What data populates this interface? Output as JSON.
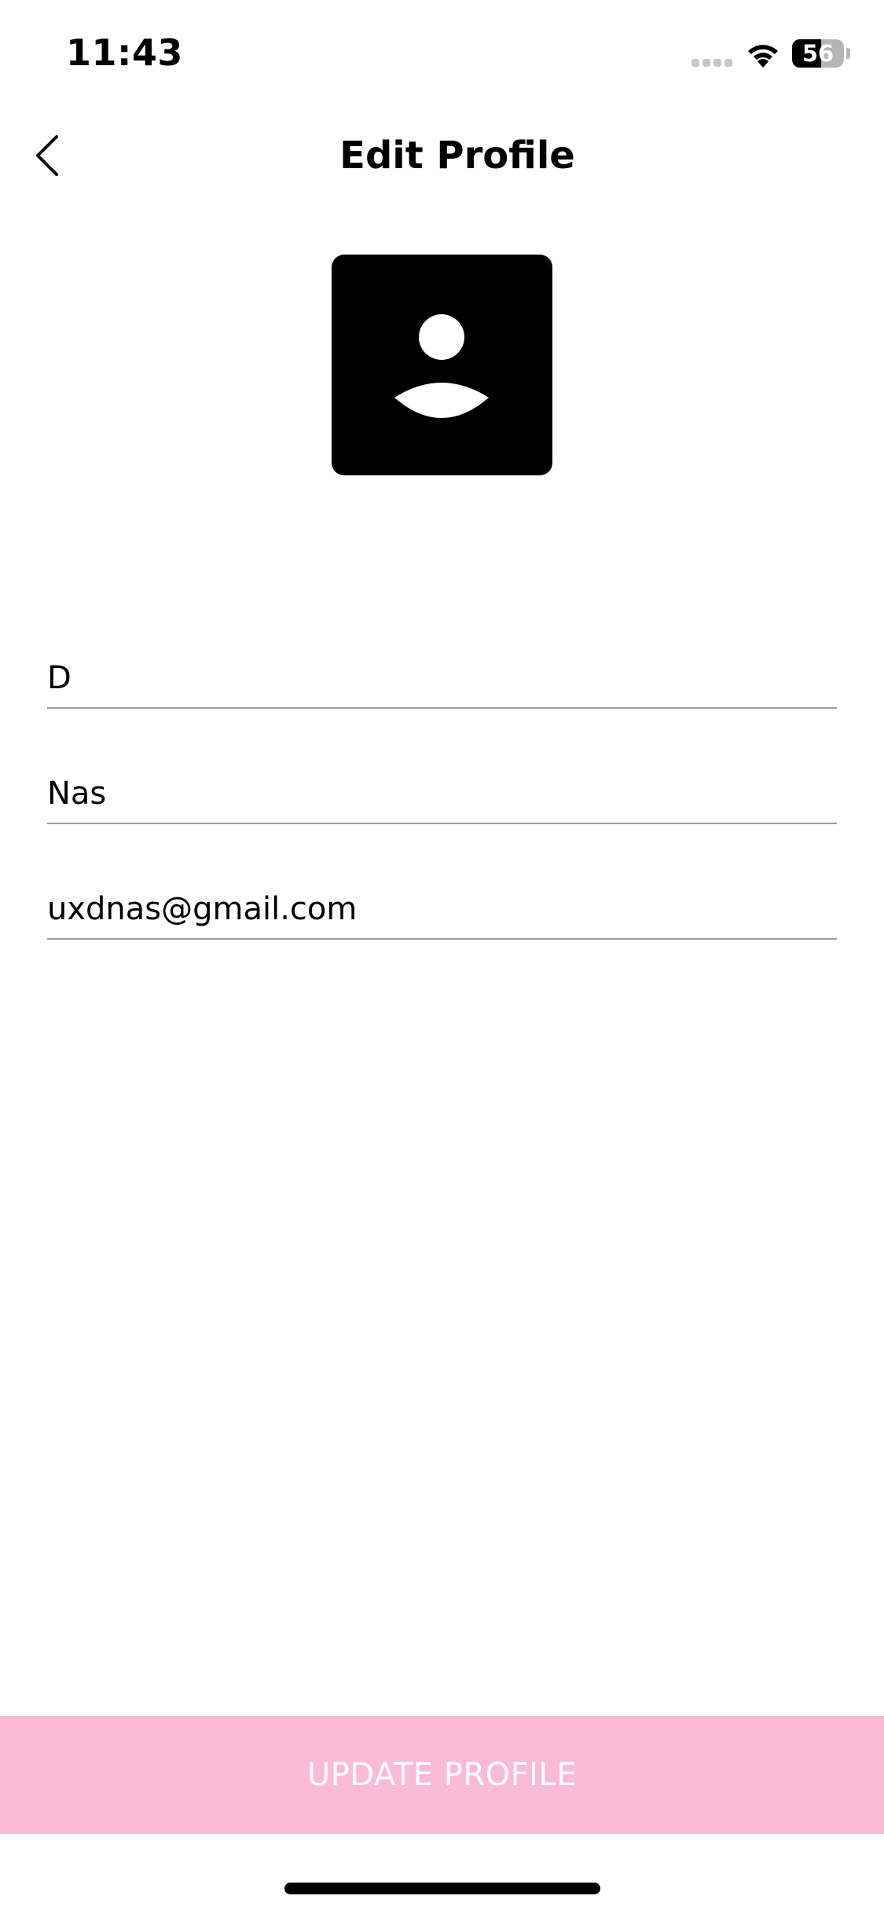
{
  "status_bar": {
    "time": "11:43",
    "battery_level": "56",
    "battery_fraction": 0.56,
    "icons": [
      "cellular-signal-icon",
      "wifi-icon",
      "battery-icon"
    ]
  },
  "header": {
    "title": "Edit Profile",
    "back_icon": "chevron-left-icon"
  },
  "avatar": {
    "icon": "person-icon"
  },
  "form": {
    "first_name": "D",
    "last_name": "Nas",
    "email": "uxdnas@gmail.com"
  },
  "update_button": {
    "label": "UPDATE PROFILE"
  },
  "colors": {
    "background": "#ffffff",
    "text": "#000000",
    "accent_button": "#fbbad8",
    "button_text": "#ffffff",
    "divider": "#9a9a9a",
    "avatar_background": "#000000"
  }
}
